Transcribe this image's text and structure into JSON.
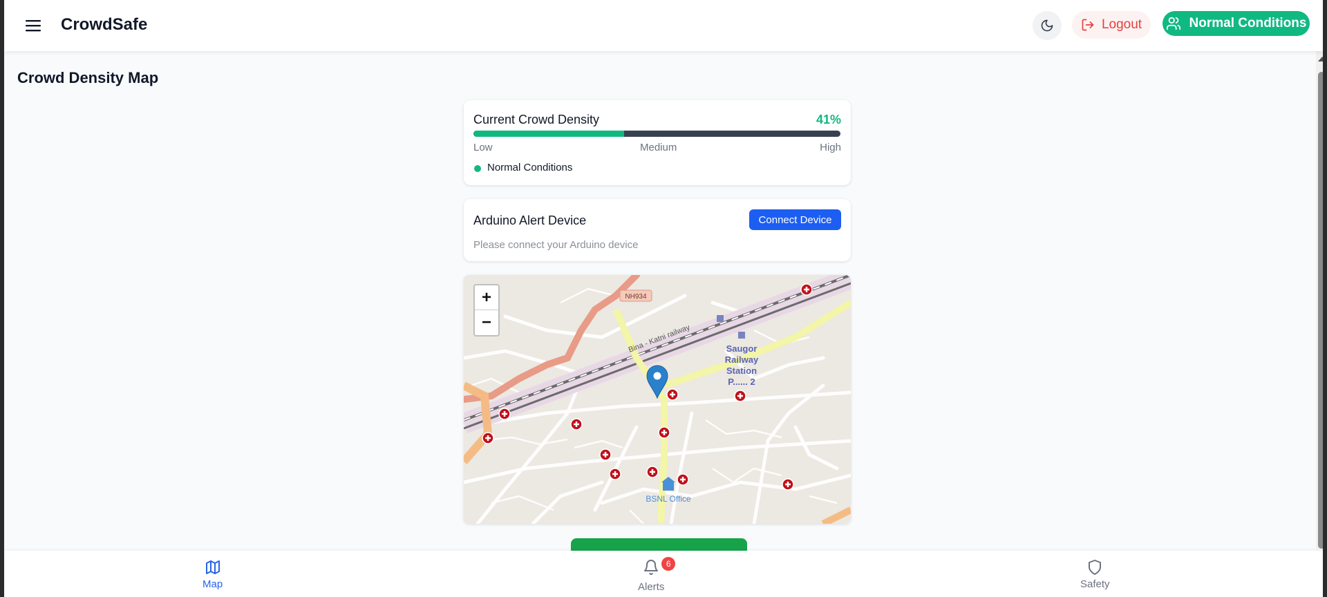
{
  "header": {
    "brand": "CrowdSafe",
    "logout_label": "Logout",
    "status_label": "Normal Conditions"
  },
  "page": {
    "title": "Crowd Density Map"
  },
  "density": {
    "label": "Current Crowd Density",
    "percent_text": "41%",
    "percent_value": 41,
    "scale_low": "Low",
    "scale_medium": "Medium",
    "scale_high": "High",
    "condition": "Normal Conditions",
    "colors": {
      "fill": "#10b981",
      "track": "#374151"
    }
  },
  "arduino": {
    "title": "Arduino Alert Device",
    "connect_label": "Connect Device",
    "subtitle": "Please connect your Arduino device"
  },
  "map": {
    "road_label": "NH934",
    "railway_label": "Bina - Katni railway",
    "station_label_lines": [
      "Saugor",
      "Railway",
      "Station",
      "P...... 2"
    ],
    "office_label": "BSNL Office",
    "zoom_in": "+",
    "zoom_out": "−"
  },
  "nav": {
    "map_label": "Map",
    "alerts_label": "Alerts",
    "alerts_count": "6",
    "safety_label": "Safety"
  },
  "icons": {
    "menu": "hamburger-icon",
    "theme": "moon-icon",
    "logout": "logout-icon",
    "status": "users-icon",
    "map": "map-icon",
    "alerts": "bell-icon",
    "safety": "shield-icon"
  },
  "colors": {
    "accent_green": "#10b981",
    "danger_red": "#e53e3e",
    "primary_blue": "#1d5ef2"
  }
}
